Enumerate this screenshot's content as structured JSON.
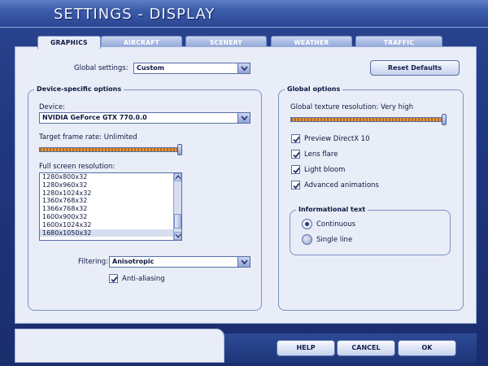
{
  "window": {
    "title": "SETTINGS - DISPLAY"
  },
  "tabs": [
    {
      "label": "GRAPHICS",
      "active": true
    },
    {
      "label": "AIRCRAFT",
      "active": false
    },
    {
      "label": "SCENERY",
      "active": false
    },
    {
      "label": "WEATHER",
      "active": false
    },
    {
      "label": "TRAFFIC",
      "active": false
    }
  ],
  "global_settings": {
    "label": "Global settings:",
    "value": "Custom",
    "reset_label": "Reset Defaults"
  },
  "device_options": {
    "title": "Device-specific options",
    "device_label": "Device:",
    "device_value": "NVIDIA GeForce GTX 770.0.0",
    "frame_rate_label": "Target frame rate: Unlimited",
    "frame_rate_level": 1.0,
    "resolution_label": "Full screen resolution:",
    "resolutions": [
      "1280x800x32",
      "1280x960x32",
      "1280x1024x32",
      "1360x768x32",
      "1366x768x32",
      "1600x900x32",
      "1600x1024x32",
      "1680x1050x32"
    ],
    "selected_resolution": "1680x1050x32",
    "filtering_label": "Filtering:",
    "filtering_value": "Anisotropic",
    "antialiasing_label": "Anti-aliasing",
    "antialiasing_checked": true
  },
  "global_options": {
    "title": "Global options",
    "texture_label": "Global texture resolution: Very high",
    "texture_level": 1.0,
    "checkboxes": [
      {
        "label": "Preview DirectX 10",
        "checked": true
      },
      {
        "label": "Lens flare",
        "checked": true
      },
      {
        "label": "Light bloom",
        "checked": true
      },
      {
        "label": "Advanced animations",
        "checked": true
      }
    ],
    "info_text": {
      "title": "Informational text",
      "options": [
        {
          "label": "Continuous",
          "selected": true
        },
        {
          "label": "Single line",
          "selected": false
        }
      ]
    }
  },
  "footer": {
    "help_label": "HELP",
    "cancel_label": "CANCEL",
    "ok_label": "OK"
  },
  "colors": {
    "window_blue": "#2a4590",
    "panel": "#e9edf7",
    "slider_fill": "#e09a3f"
  }
}
